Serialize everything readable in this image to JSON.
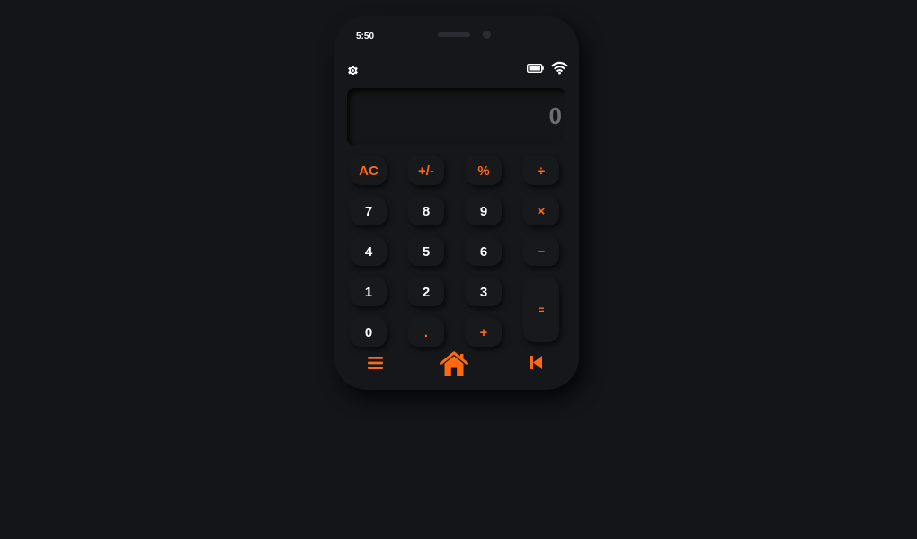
{
  "status_bar": {
    "time": "5:50",
    "icons": [
      "gear-icon",
      "battery-icon",
      "wifi-icon"
    ]
  },
  "display": {
    "value": "0"
  },
  "keys": [
    {
      "label": "AC",
      "name": "clear-button",
      "kind": "op"
    },
    {
      "label": "+/-",
      "name": "sign-toggle-button",
      "kind": "op"
    },
    {
      "label": "%",
      "name": "percent-button",
      "kind": "op"
    },
    {
      "label": "÷",
      "name": "divide-button",
      "kind": "op"
    },
    {
      "label": "7",
      "name": "digit-7-button",
      "kind": "num"
    },
    {
      "label": "8",
      "name": "digit-8-button",
      "kind": "num"
    },
    {
      "label": "9",
      "name": "digit-9-button",
      "kind": "num"
    },
    {
      "label": "×",
      "name": "multiply-button",
      "kind": "op"
    },
    {
      "label": "4",
      "name": "digit-4-button",
      "kind": "num"
    },
    {
      "label": "5",
      "name": "digit-5-button",
      "kind": "num"
    },
    {
      "label": "6",
      "name": "digit-6-button",
      "kind": "num"
    },
    {
      "label": "−",
      "name": "subtract-button",
      "kind": "op"
    },
    {
      "label": "1",
      "name": "digit-1-button",
      "kind": "num"
    },
    {
      "label": "2",
      "name": "digit-2-button",
      "kind": "num"
    },
    {
      "label": "3",
      "name": "digit-3-button",
      "kind": "num"
    },
    {
      "label": "=",
      "name": "equals-button",
      "kind": "op"
    },
    {
      "label": "0",
      "name": "digit-0-button",
      "kind": "num"
    },
    {
      "label": ".",
      "name": "decimal-button",
      "kind": "op"
    },
    {
      "label": "+",
      "name": "add-button",
      "kind": "op"
    }
  ],
  "bottom_nav": {
    "icons": [
      "menu-icon",
      "home-icon",
      "back-icon"
    ]
  },
  "colors": {
    "background": "#131519",
    "accent": "#ff6a10",
    "text": "#ffffff",
    "display_text": "#6d6e71"
  }
}
